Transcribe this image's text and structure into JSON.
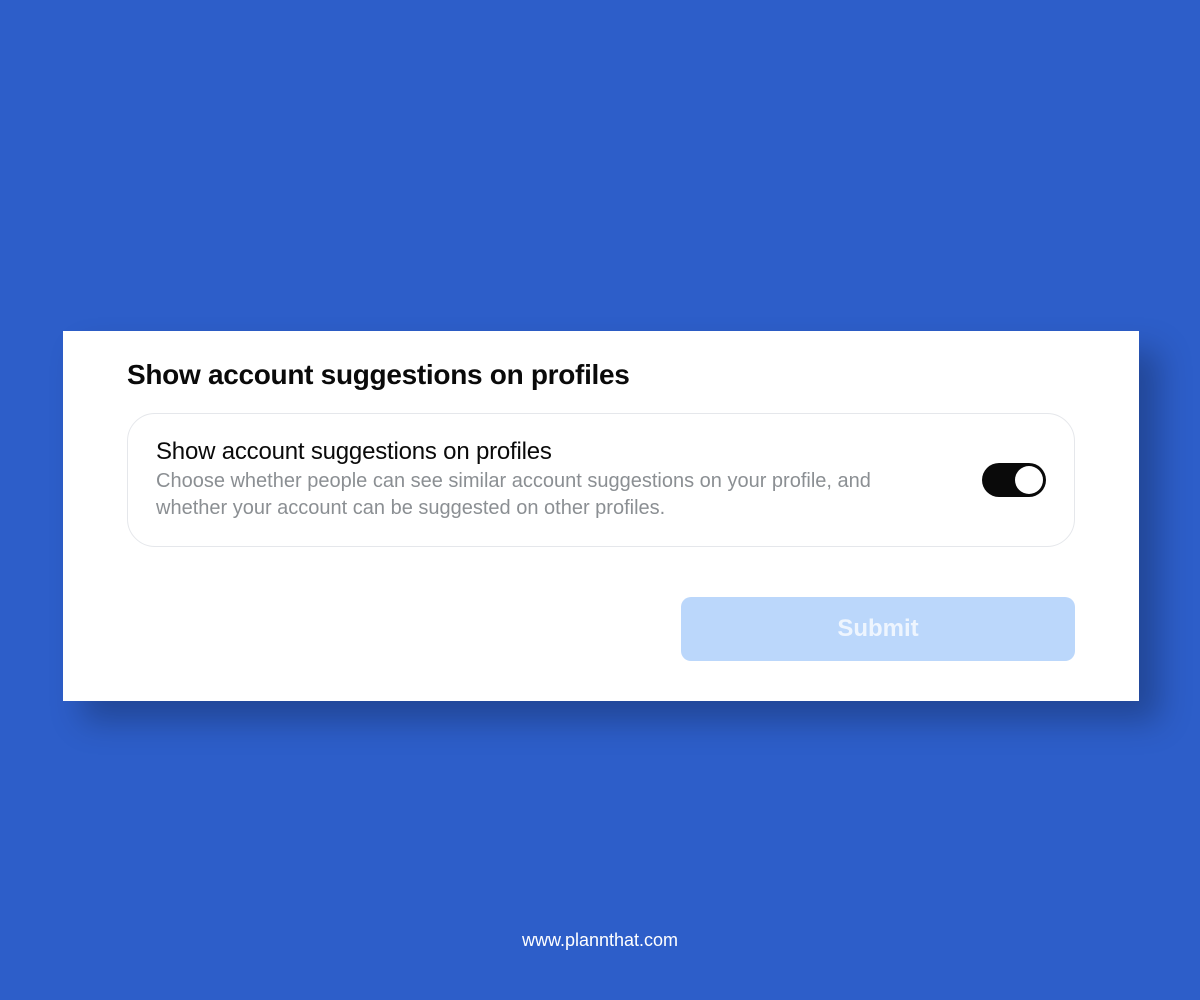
{
  "panel": {
    "header": "Show account suggestions on profiles",
    "setting": {
      "title": "Show account suggestions on profiles",
      "description": "Choose whether people can see similar account suggestions on your profile, and whether your account can be suggested on other profiles.",
      "enabled": true
    },
    "submit_label": "Submit"
  },
  "footer": {
    "url": "www.plannthat.com"
  }
}
